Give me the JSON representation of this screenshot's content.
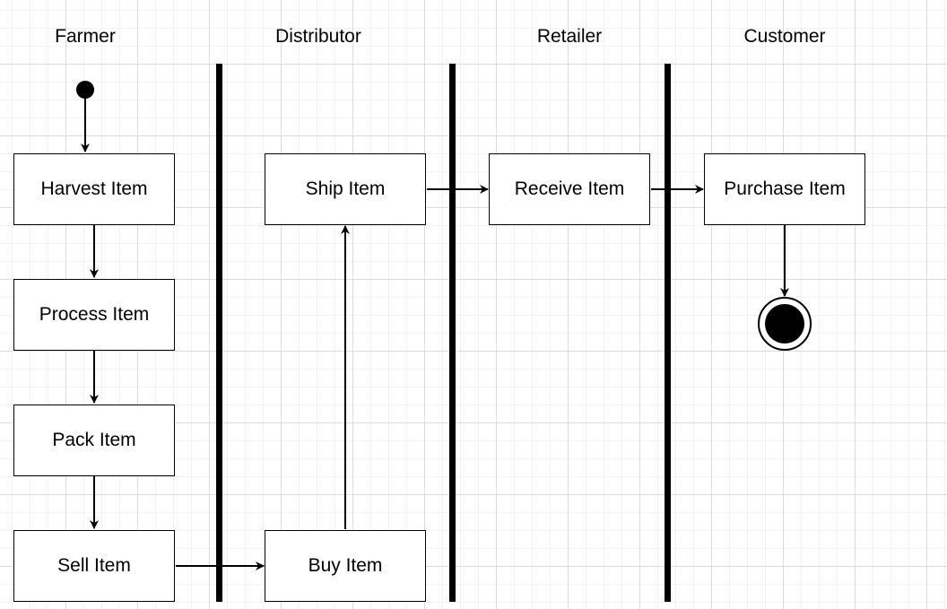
{
  "lanes": {
    "farmer": "Farmer",
    "distributor": "Distributor",
    "retailer": "Retailer",
    "customer": "Customer"
  },
  "nodes": {
    "harvest": "Harvest Item",
    "process": "Process Item",
    "pack": "Pack Item",
    "sell": "Sell Item",
    "buy": "Buy Item",
    "ship": "Ship Item",
    "receive": "Receive Item",
    "purchase": "Purchase Item"
  }
}
